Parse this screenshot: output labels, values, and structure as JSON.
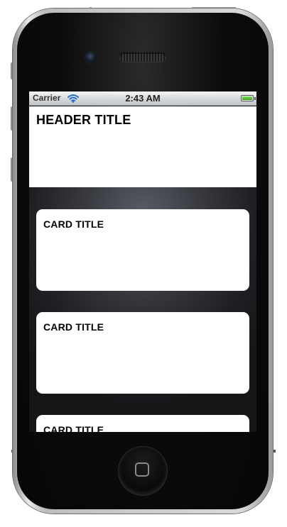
{
  "status_bar": {
    "carrier": "Carrier",
    "time": "2:43 AM",
    "wifi_icon": "wifi-icon",
    "battery_icon": "battery-icon",
    "battery_level": 1.0
  },
  "header": {
    "title": "HEADER TITLE"
  },
  "cards": [
    {
      "title": "CARD TITLE"
    },
    {
      "title": "CARD TITLE"
    },
    {
      "title": "CARD TITLE"
    }
  ],
  "device": {
    "home_button_icon": "home-square-icon"
  },
  "colors": {
    "header_bg": "#ffffff",
    "card_bg": "#ffffff",
    "screen_bg": "#3a3c42",
    "battery": "#5ecb3f"
  }
}
